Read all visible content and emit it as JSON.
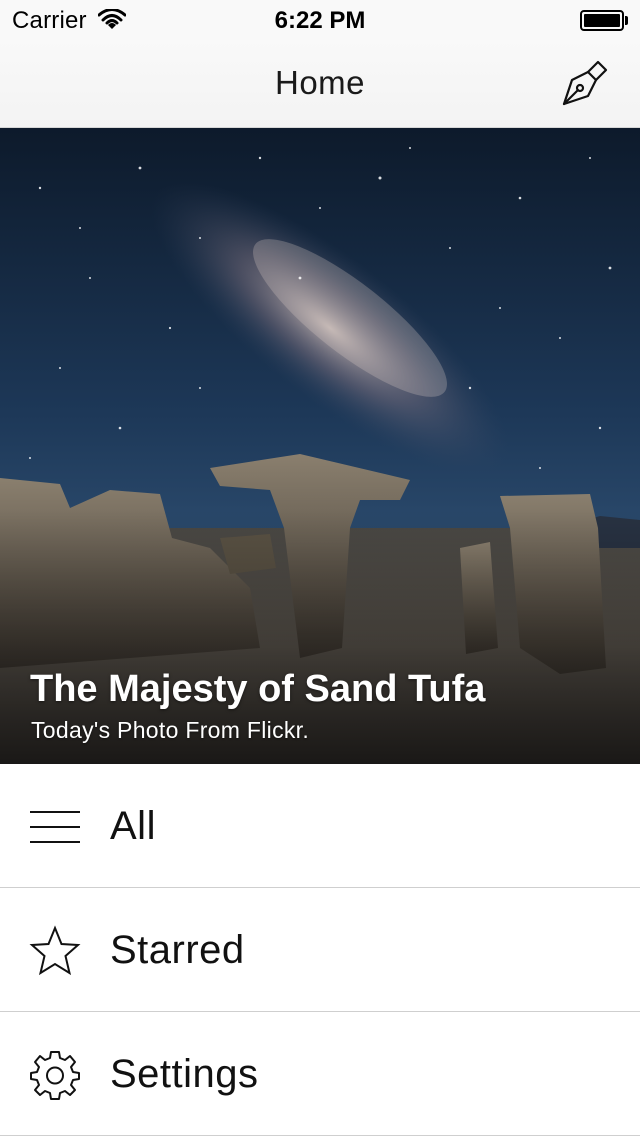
{
  "status_bar": {
    "carrier": "Carrier",
    "time": "6:22 PM"
  },
  "nav": {
    "title": "Home",
    "compose_icon": "pen-nib-icon"
  },
  "hero": {
    "title": "The Majesty of Sand Tufa",
    "subtitle": "Today's Photo From Flickr."
  },
  "menu": {
    "items": [
      {
        "label": "All",
        "icon": "menu-lines-icon"
      },
      {
        "label": "Starred",
        "icon": "star-icon"
      },
      {
        "label": "Settings",
        "icon": "gear-icon"
      }
    ]
  }
}
